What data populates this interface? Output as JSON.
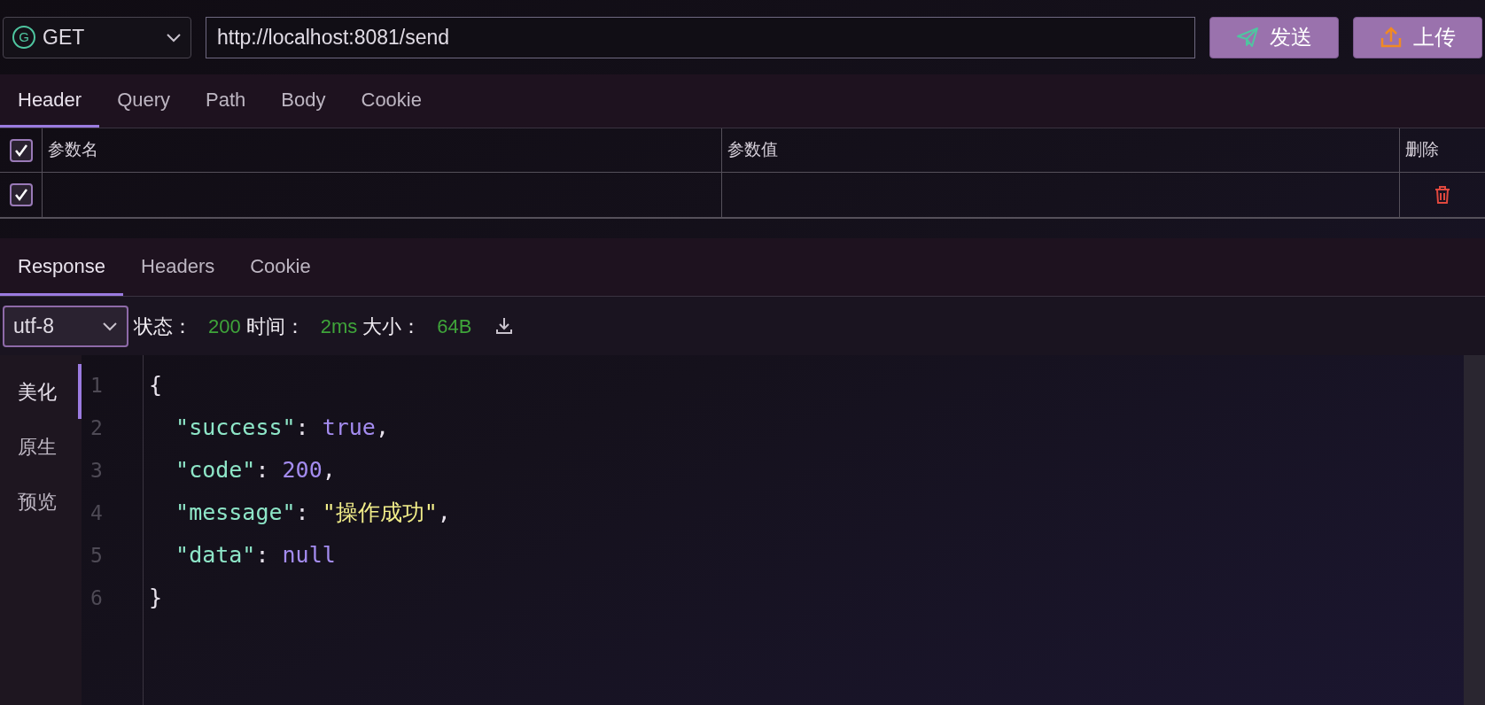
{
  "request": {
    "method": {
      "letter": "G",
      "value": "GET"
    },
    "url": "http://localhost:8081/send",
    "buttons": [
      {
        "kind": "send",
        "label": "发送"
      },
      {
        "kind": "upload",
        "label": "上传"
      }
    ]
  },
  "request_tabs": [
    {
      "label": "Header",
      "selected": true
    },
    {
      "label": "Query",
      "selected": false
    },
    {
      "label": "Path",
      "selected": false
    },
    {
      "label": "Body",
      "selected": false
    },
    {
      "label": "Cookie",
      "selected": false
    }
  ],
  "params_table": {
    "all_checked": true,
    "columns": [
      "参数名",
      "参数值",
      "删除"
    ],
    "rows": [
      {
        "checked": true
      }
    ]
  },
  "response_tabs": [
    {
      "label": "Response",
      "selected": true
    },
    {
      "label": "Headers",
      "selected": false
    },
    {
      "label": "Cookie",
      "selected": false
    }
  ],
  "response_bar": {
    "encoding": "utf-8",
    "stats": [
      {
        "label": "状态：",
        "value": "200"
      },
      {
        "label": "时间：",
        "value": "2ms"
      },
      {
        "label": "大小：",
        "value": "64B"
      }
    ]
  },
  "view_modes": [
    {
      "label": "美化",
      "selected": true
    },
    {
      "label": "原生",
      "selected": false
    },
    {
      "label": "预览",
      "selected": false
    }
  ],
  "code": {
    "lines": [
      {
        "number": "1",
        "tokens": [
          {
            "kind": "punct",
            "text": "{"
          }
        ]
      },
      {
        "number": "2",
        "tokens": [
          {
            "kind": "key",
            "text": "  \"success\""
          },
          {
            "kind": "punct",
            "text": ": "
          },
          {
            "kind": "literal",
            "text": "true"
          },
          {
            "kind": "plain",
            "text": ","
          }
        ]
      },
      {
        "number": "3",
        "tokens": [
          {
            "kind": "key",
            "text": "  \"code\""
          },
          {
            "kind": "punct",
            "text": ": "
          },
          {
            "kind": "literal",
            "text": "200"
          },
          {
            "kind": "plain",
            "text": ","
          }
        ]
      },
      {
        "number": "4",
        "tokens": [
          {
            "kind": "key",
            "text": "  \"message\""
          },
          {
            "kind": "punct",
            "text": ": "
          },
          {
            "kind": "string",
            "text": "\"操作成功\""
          },
          {
            "kind": "plain",
            "text": ","
          }
        ]
      },
      {
        "number": "5",
        "tokens": [
          {
            "kind": "key",
            "text": "  \"data\""
          },
          {
            "kind": "punct",
            "text": ": "
          },
          {
            "kind": "literal",
            "text": "null"
          }
        ]
      },
      {
        "number": "6",
        "tokens": [
          {
            "kind": "punct",
            "text": "}"
          }
        ]
      }
    ]
  }
}
